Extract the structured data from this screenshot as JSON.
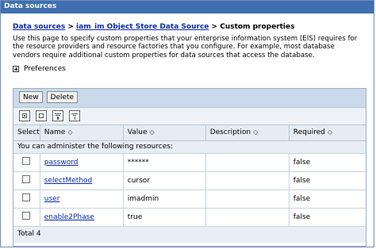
{
  "window": {
    "title": "Data sources"
  },
  "breadcrumb": {
    "item1": "Data sources",
    "sep1": " > ",
    "item2": "iam_im Object Store Data Source",
    "sep2": " > ",
    "current": "Custom properties"
  },
  "description": "Use this page to specify custom properties that your enterprise information system (EIS) requires for the resource providers and resource factories that you configure. For example, most database vendors require additional custom properties for data sources that access the database.",
  "preferences": {
    "label": "Preferences"
  },
  "toolbar": {
    "new_label": "New",
    "delete_label": "Delete"
  },
  "table": {
    "columns": {
      "select": "Select",
      "name": "Name",
      "value": "Value",
      "description": "Description",
      "required": "Required"
    },
    "sort_icon": "◇",
    "info_row": "You can administer the following resources:",
    "rows": [
      {
        "name": "password",
        "value": "******",
        "description": "",
        "required": "false"
      },
      {
        "name": "selectMethod",
        "value": "cursor",
        "description": "",
        "required": "false"
      },
      {
        "name": "user",
        "value": "imadmin",
        "description": "",
        "required": "false"
      },
      {
        "name": "enable2Phase",
        "value": "true",
        "description": "",
        "required": "false"
      }
    ],
    "total": "Total 4"
  }
}
